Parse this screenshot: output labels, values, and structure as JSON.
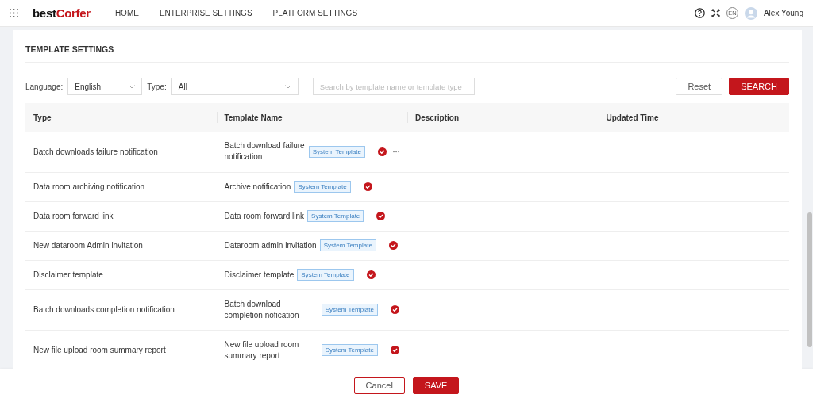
{
  "topbar": {
    "logo": {
      "dark": "best",
      "accent": "Corfer"
    },
    "nav": [
      {
        "label": "HOME",
        "selected": false
      },
      {
        "label": "ENTERPRISE SETTINGS",
        "selected": false
      },
      {
        "label": "PLATFORM SETTINGS",
        "selected": false
      }
    ],
    "language_badge": "EN",
    "user": "Alex Young"
  },
  "section_title": "TEMPLATE SETTINGS",
  "filters": {
    "language_label": "Language:",
    "language_value": "English",
    "type_label": "Type:",
    "type_value": "All",
    "search": {
      "placeholder": "Search by template name or template type"
    },
    "buttons": [
      {
        "label": "Reset",
        "kind": "secondary"
      },
      {
        "label": "SEARCH",
        "kind": "primary"
      }
    ]
  },
  "table": {
    "columns": [
      "Type",
      "Template Name",
      "Description",
      "Updated Time"
    ],
    "rows": [
      {
        "type": "Batch downloads failure notification",
        "template_name": "Batch download failure notification",
        "tag": "System Template",
        "enabled": true,
        "more": true
      },
      {
        "type": "Data room archiving notification",
        "template_name": "Archive notification",
        "tag": "System Template",
        "enabled": true,
        "more": false
      },
      {
        "type": "Data room forward link",
        "template_name": "Data room forward link",
        "tag": "System Template",
        "enabled": true,
        "more": false
      },
      {
        "type": "New dataroom Admin invitation",
        "template_name": "Dataroom admin invitation",
        "tag": "System Template",
        "enabled": true,
        "more": false
      },
      {
        "type": "Disclaimer template",
        "template_name": "Disclaimer template",
        "tag": "System Template",
        "enabled": true,
        "more": false
      },
      {
        "type": "Batch downloads completion notification",
        "template_name": "Batch download completion nofication",
        "tag": "System Template",
        "enabled": true,
        "more": false
      },
      {
        "type": "New file upload room summary report",
        "template_name": "New file upload room summary report",
        "tag": "System Template",
        "enabled": true,
        "more": false
      }
    ]
  },
  "footer": {
    "buttons": [
      {
        "label": "Cancel",
        "kind": "secondary"
      },
      {
        "label": "SAVE",
        "kind": "primary"
      }
    ]
  }
}
